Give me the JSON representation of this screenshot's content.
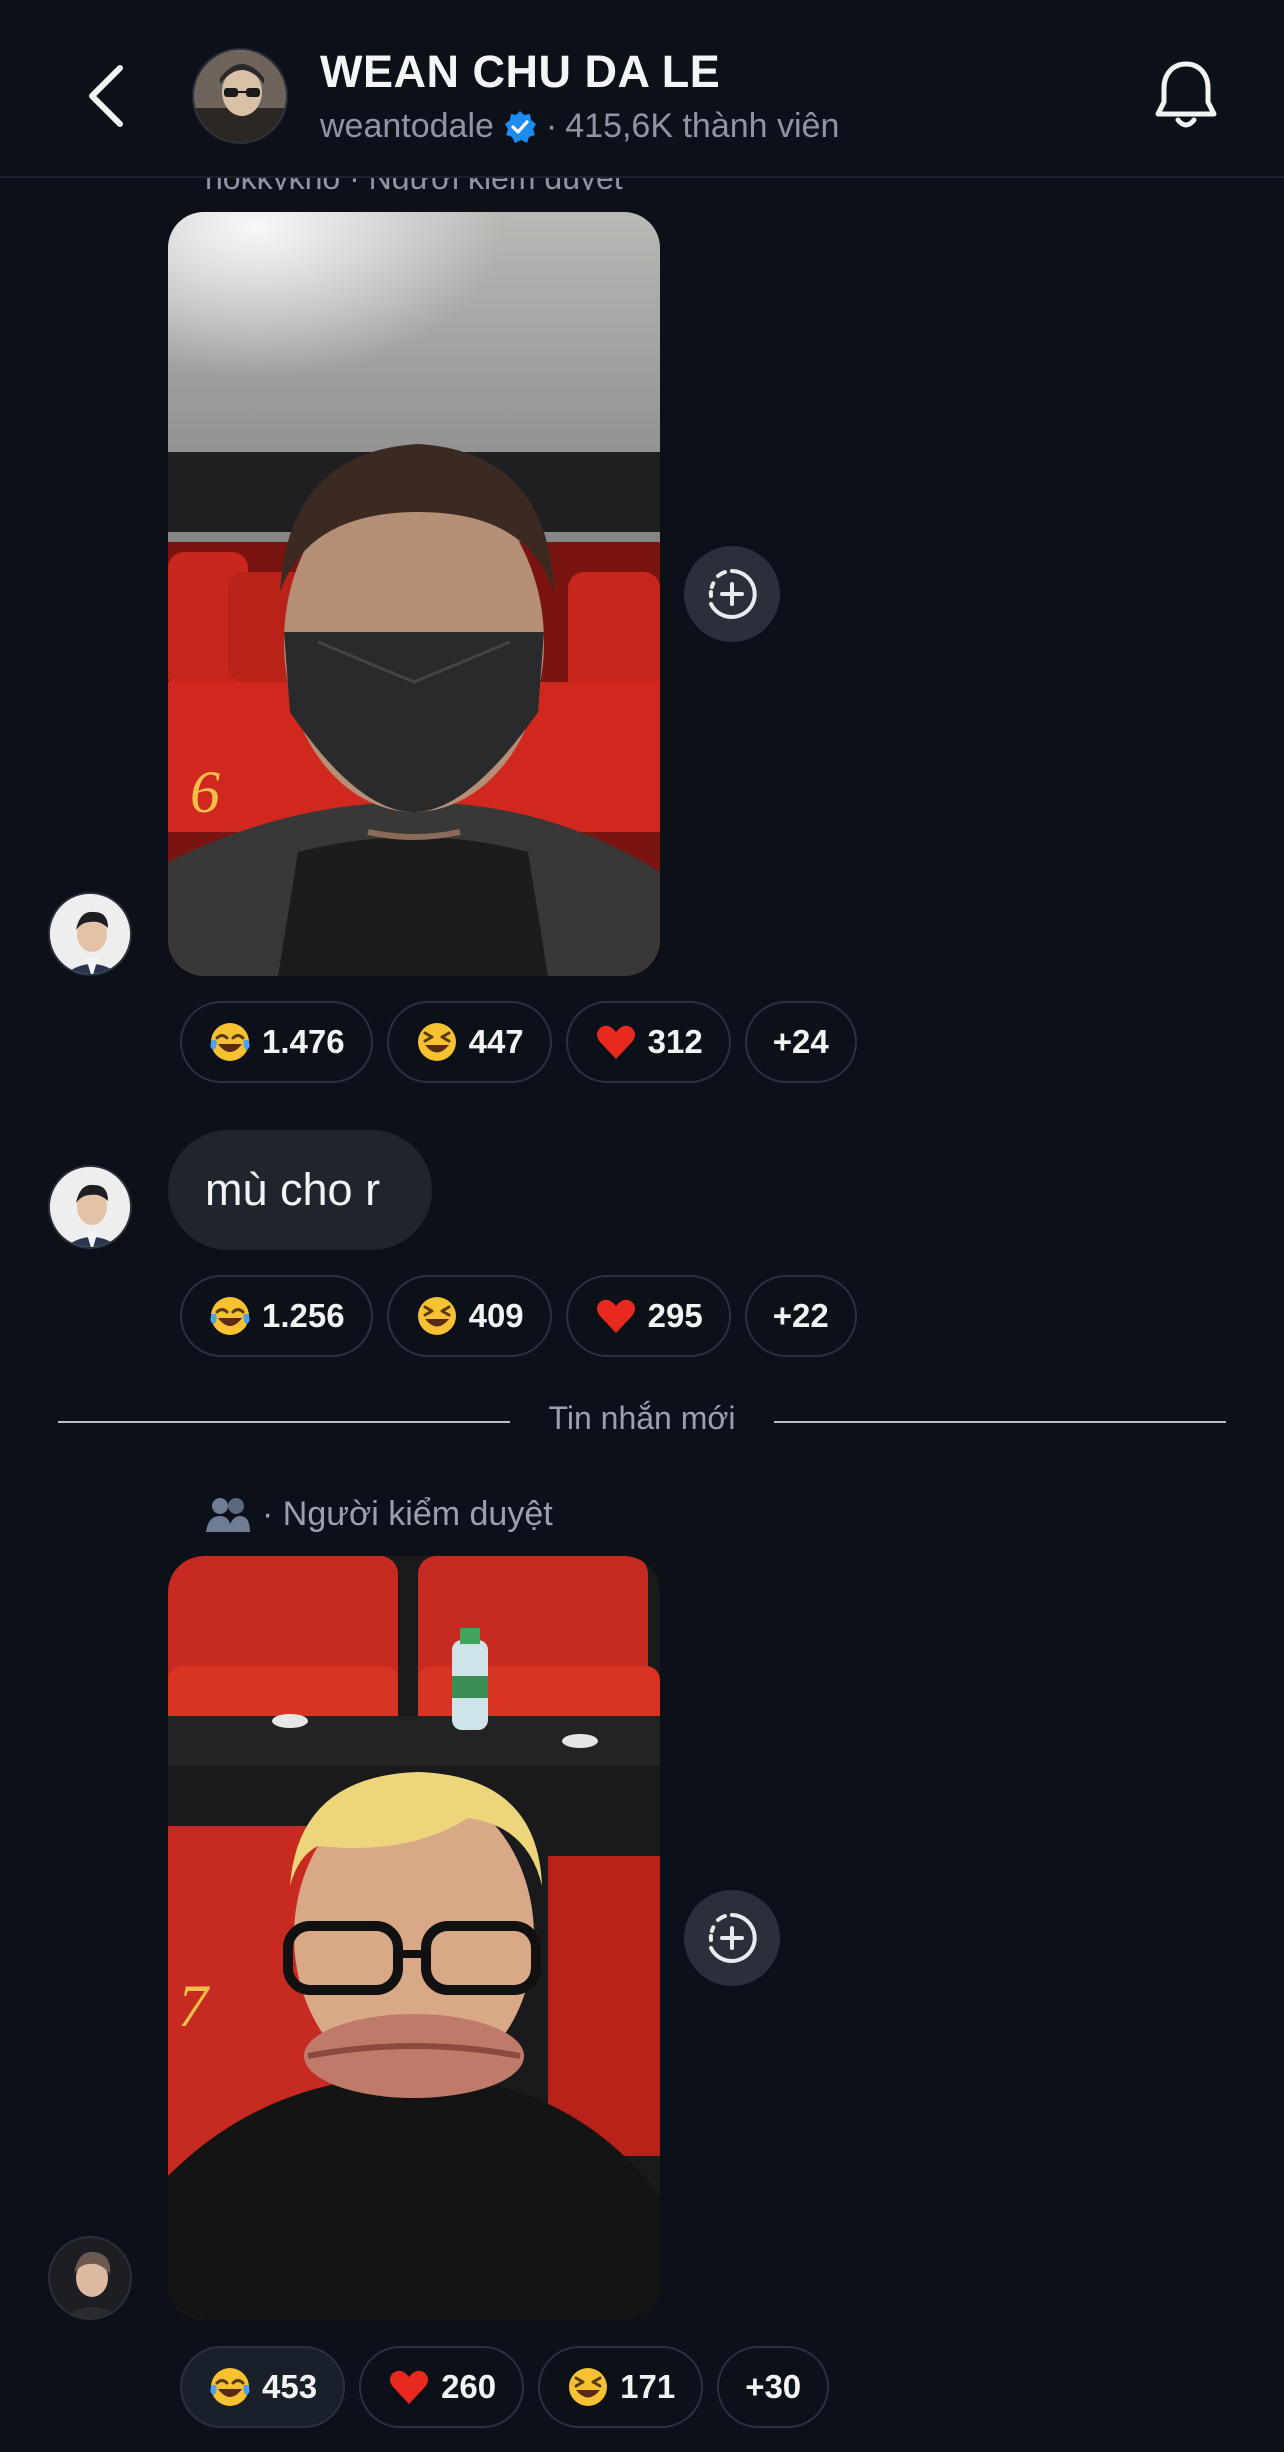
{
  "header": {
    "title": "WEAN CHU DA LE",
    "username": "weantodale",
    "separator": "·",
    "members": "415,6K thành viên"
  },
  "clipped_moderator_text": "nokkykno · Người kiểm duyệt",
  "messages": [
    {
      "type": "video",
      "reactions": [
        {
          "emoji": "tears-of-joy",
          "count": "1.476",
          "active": false
        },
        {
          "emoji": "grinning-squint",
          "count": "447",
          "active": false
        },
        {
          "emoji": "red-heart",
          "count": "312",
          "active": false
        },
        {
          "emoji": "",
          "count": "+24",
          "active": false
        }
      ]
    },
    {
      "type": "text",
      "text": "mù cho r",
      "reactions": [
        {
          "emoji": "tears-of-joy",
          "count": "1.256",
          "active": false
        },
        {
          "emoji": "grinning-squint",
          "count": "409",
          "active": false
        },
        {
          "emoji": "red-heart",
          "count": "295",
          "active": false
        },
        {
          "emoji": "",
          "count": "+22",
          "active": false
        }
      ]
    },
    {
      "type": "video",
      "moderator_label": "· Người kiểm duyệt",
      "reactions": [
        {
          "emoji": "tears-of-joy",
          "count": "453",
          "active": true
        },
        {
          "emoji": "red-heart",
          "count": "260",
          "active": false
        },
        {
          "emoji": "grinning-squint",
          "count": "171",
          "active": false
        },
        {
          "emoji": "",
          "count": "+30",
          "active": false
        }
      ]
    }
  ],
  "divider_label": "Tin nhắn mới",
  "colors": {
    "background": "#0c1018",
    "verified": "#1d8cf0",
    "bubble": "#1f242d",
    "pill_border": "#2b313b",
    "muted_text": "#8f96a3"
  }
}
